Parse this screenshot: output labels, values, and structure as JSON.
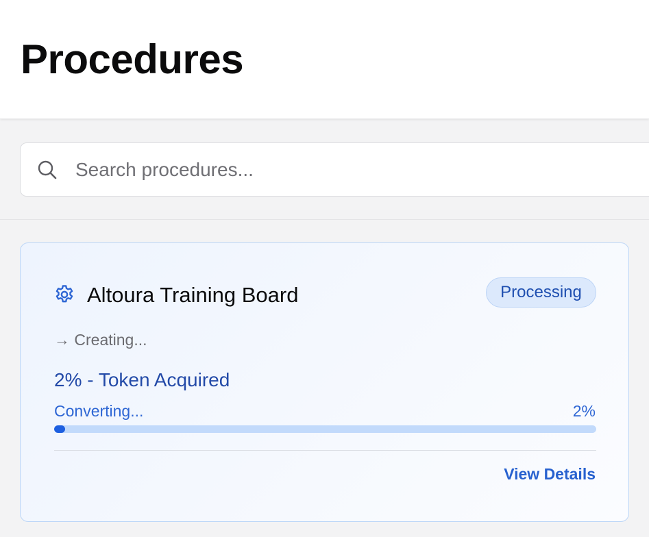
{
  "header": {
    "title": "Procedures"
  },
  "search": {
    "placeholder": "Search procedures...",
    "value": ""
  },
  "icons": {
    "search": "search-icon",
    "settings": "gear-icon"
  },
  "colors": {
    "accent": "#1d5fe0",
    "badge_bg": "#dce9fc",
    "badge_text": "#1f4fb0",
    "track": "#c2dafb"
  },
  "procedures": [
    {
      "name": "Altoura Training Board",
      "status": "Processing",
      "stage": "→ Creating...",
      "headline": "2% - Token Acquired",
      "step_label": "Converting...",
      "progress_text": "2%",
      "progress": 0.02,
      "action_label": "View Details"
    }
  ]
}
